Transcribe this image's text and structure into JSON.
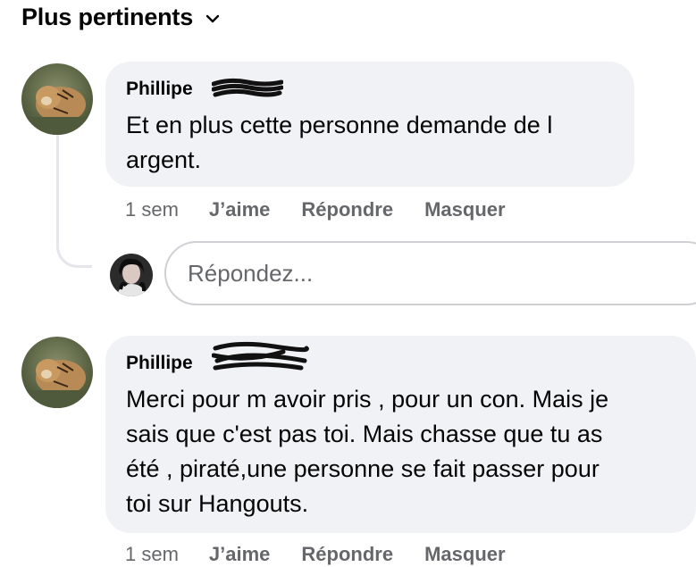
{
  "header": {
    "sort_label": "Plus pertinents"
  },
  "comments": [
    {
      "author": "Phillipe",
      "text": "Et en plus cette personne demande de l\nargent.",
      "time": "1 sem",
      "like_label": "J’aime",
      "reply_label": "Répondre",
      "hide_label": "Masquer"
    },
    {
      "author": "Phillipe",
      "text": "Merci pour m avoir pris , pour un con. Mais je\nsais que c'est pas toi. Mais chasse que tu as\nété , piraté,une personne se fait passer pour\ntoi sur Hangouts.",
      "time": "1 sem",
      "like_label": "J’aime",
      "reply_label": "Répondre",
      "hide_label": "Masquer"
    }
  ],
  "reply_box": {
    "placeholder": "Répondez..."
  },
  "colors": {
    "bubble": "#f0f2f5",
    "secondary_text": "#65676b",
    "border": "#ced0d4"
  },
  "icons": {
    "sort_toggle": "chevron-down-icon"
  }
}
